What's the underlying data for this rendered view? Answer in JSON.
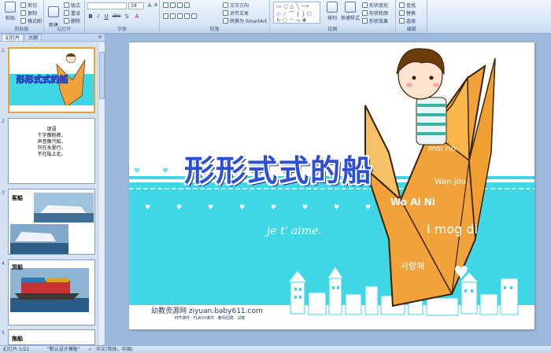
{
  "ribbon": {
    "clipboard": {
      "paste": "粘贴",
      "cut": "剪切",
      "copy": "复制",
      "format_painter": "格式刷",
      "label": "剪贴板"
    },
    "slides": {
      "new_slide": "新建\n幻灯片",
      "layout": "版式",
      "reset": "重设",
      "delete": "删除",
      "label": "幻灯片"
    },
    "font": {
      "size": "18",
      "bold": "B",
      "italic": "I",
      "underline": "U",
      "strike": "abc",
      "shadow": "S",
      "label": "字体"
    },
    "paragraph": {
      "text_direction": "文字方向",
      "align_text": "对齐文本",
      "convert_smartart": "转换为 SmartArt",
      "label": "段落"
    },
    "drawing": {
      "arrange": "排列",
      "quick_styles": "快速样式",
      "shape_fill": "形状填充",
      "shape_outline": "形状轮廓",
      "shape_effects": "形状效果",
      "label": "绘图"
    },
    "editing": {
      "find": "查找",
      "replace": "替换",
      "select": "选择",
      "label": "编辑"
    }
  },
  "panel": {
    "tabs": [
      "幻灯片",
      "大纲"
    ],
    "close": "×",
    "thumb1_title": "形形式式的船",
    "thumb2_lines": [
      "谜语",
      "个字像粉裤，",
      "声音像汽船，",
      "只在水里行，",
      "不在陆上走。"
    ],
    "thumb3_label": "客船",
    "thumb4_label": "货船",
    "thumb5_label": "拖船",
    "numbers": [
      "1",
      "2",
      "3",
      "4",
      "5"
    ]
  },
  "slide": {
    "title": "形形式式的船",
    "jet": "je t' aime.",
    "footer": "幼教资源网 ziyuan.baby611.com",
    "footer_sub": "PPT课件 · FLASH课件 · 教师招聘 · 试卷",
    "words": [
      "moi rin",
      "Wan jou",
      "Wo Ai Ni",
      "I mog di",
      "사랑해"
    ]
  },
  "status": {
    "slide_info": "幻灯片 1/21",
    "theme": "\"默认设计模板\"",
    "language": "中文(简体，中国)"
  },
  "colors": {
    "accent_cyan": "#3fd6e6",
    "title_blue": "#2d4fd8",
    "crane_orange": "#f2a23a"
  }
}
